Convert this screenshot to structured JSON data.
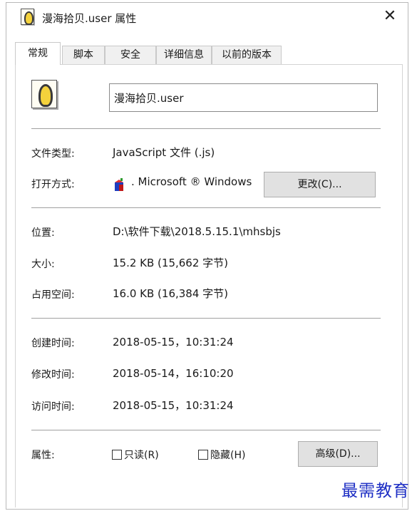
{
  "window": {
    "title": "漫海拾贝.user 属性",
    "close_glyph": "✕"
  },
  "tabs": [
    {
      "label": "常规",
      "active": true
    },
    {
      "label": "脚本",
      "active": false
    },
    {
      "label": "安全",
      "active": false
    },
    {
      "label": "详细信息",
      "active": false
    },
    {
      "label": "以前的版本",
      "active": false
    }
  ],
  "general": {
    "file_name": "漫海拾贝.user",
    "file_type_label": "文件类型:",
    "file_type_value": "JavaScript 文件 (.js)",
    "open_with_label": "打开方式:",
    "open_with_value": ". Microsoft ® Windows",
    "change_button": "更改(C)...",
    "location_label": "位置:",
    "location_value": "D:\\软件下载\\2018.5.15.1\\mhsbjs",
    "size_label": "大小:",
    "size_value": "15.2 KB (15,662 字节)",
    "size_on_disk_label": "占用空间:",
    "size_on_disk_value": "16.0 KB (16,384 字节)",
    "created_label": "创建时间:",
    "created_value": "2018-05-15，10:31:24",
    "modified_label": "修改时间:",
    "modified_value": "2018-05-14，16:10:20",
    "accessed_label": "访问时间:",
    "accessed_value": "2018-05-15，10:31:24",
    "attributes_label": "属性:",
    "readonly_label": "只读(R)",
    "readonly_checked": false,
    "hidden_label": "隐藏(H)",
    "hidden_checked": false,
    "advanced_button": "高级(D)..."
  },
  "watermark": "最需教育",
  "icons": {
    "app_icon": "javascript-file-icon",
    "file_icon": "javascript-file-icon",
    "open_with_icon": "windows-script-host-icon"
  }
}
